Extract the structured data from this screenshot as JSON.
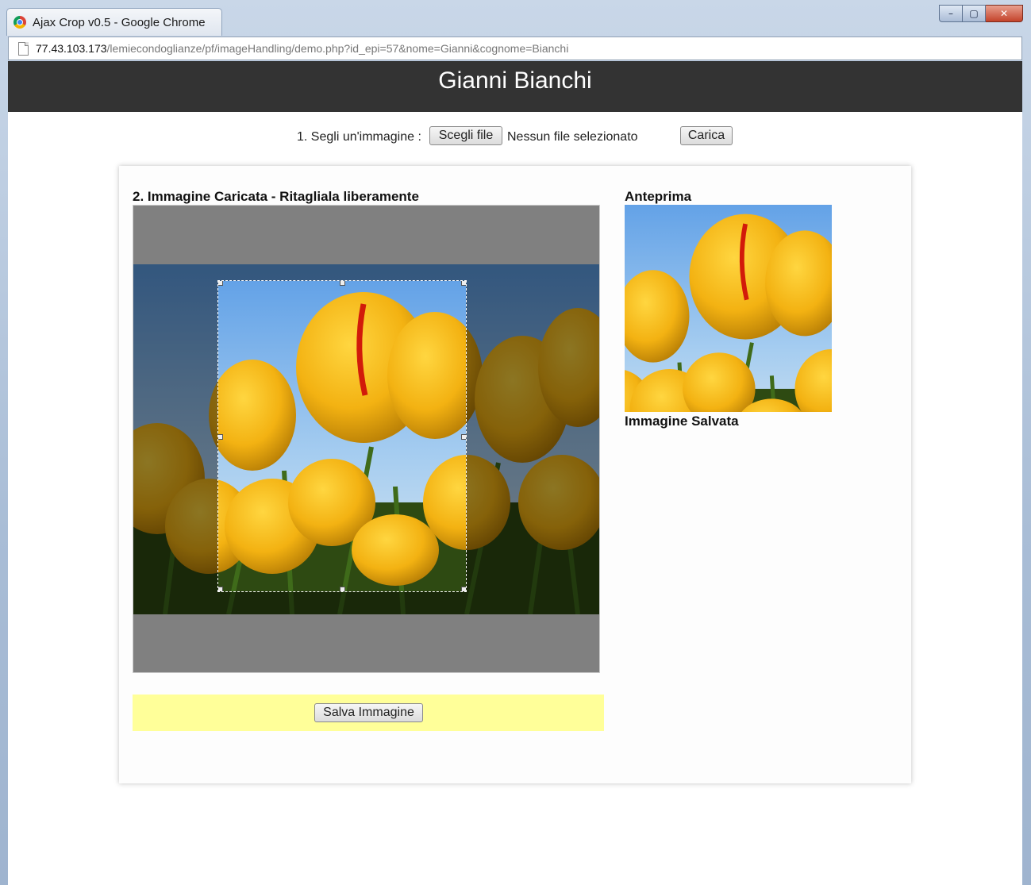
{
  "window": {
    "tab_title": "Ajax Crop v0.5 - Google Chrome",
    "controls": {
      "minimize": "–",
      "maximize": "▢",
      "close": "✕"
    }
  },
  "address_bar": {
    "url_host": "77.43.103.173",
    "url_path": "/lemiecondoglianze/pf/imageHandling/demo.php?id_epi=57&nome=Gianni&cognome=Bianchi"
  },
  "header": {
    "title": "Gianni Bianchi",
    "background": "#333333"
  },
  "upload": {
    "label": "1. Segli un'immagine :",
    "choose_button": "Scegli file",
    "no_file_text": "Nessun file selezionato",
    "upload_button": "Carica"
  },
  "crop": {
    "title": "2. Immagine Caricata - Ritagliala liberamente",
    "save_button": "Salva Immagine",
    "save_area_color": "#ffff99"
  },
  "preview": {
    "title": "Anteprima",
    "saved_title": "Immagine Salvata"
  }
}
